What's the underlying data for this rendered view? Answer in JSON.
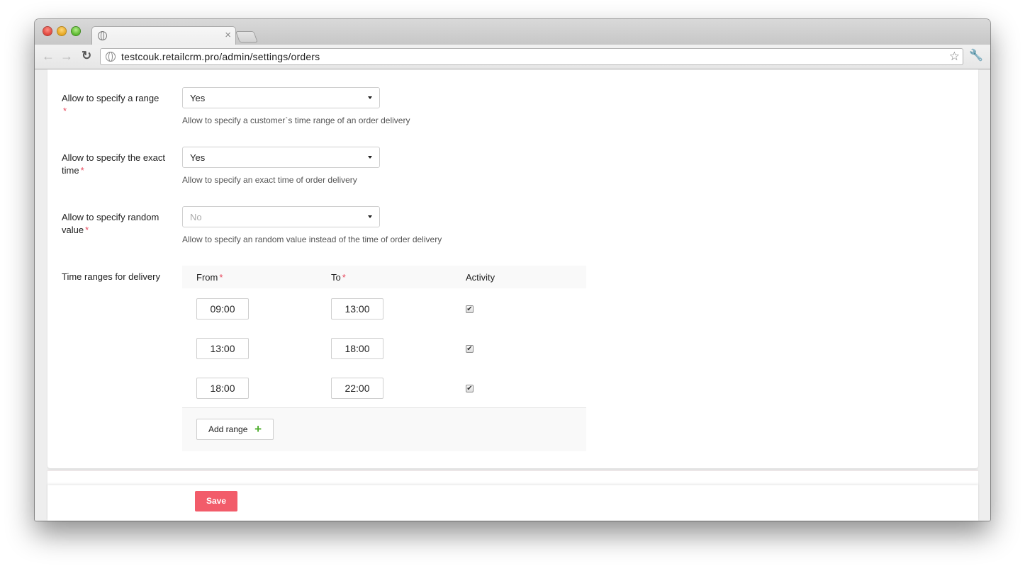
{
  "browser": {
    "url_host": "testcouk.retailcrm.pro",
    "url_path": "/admin/settings/orders",
    "tab_close": "×",
    "icons": [
      "globe-icon",
      "back-arrow-icon",
      "forward-arrow-icon",
      "reload-icon",
      "star-icon",
      "wrench-icon"
    ]
  },
  "form": {
    "range": {
      "label": "Allow to specify a range",
      "value": "Yes",
      "help": "Allow to specify a customer`s time range of an order delivery"
    },
    "exact": {
      "label": "Allow to specify the exact time",
      "value": "Yes",
      "help": "Allow to specify an exact time of order delivery"
    },
    "random": {
      "label": "Allow to specify random value",
      "value": "No",
      "help": "Allow to specify an random value instead of the time of order delivery"
    },
    "required_mark": "*",
    "time_ranges": {
      "label": "Time ranges for delivery",
      "columns": [
        "From",
        "To",
        "Activity"
      ],
      "rows": [
        {
          "from": "09:00",
          "to": "13:00",
          "active": true
        },
        {
          "from": "13:00",
          "to": "18:00",
          "active": true
        },
        {
          "from": "18:00",
          "to": "22:00",
          "active": true
        }
      ],
      "add_label": "Add range",
      "add_icon": "+"
    },
    "save_label": "Save"
  },
  "colors": {
    "accent": "#f25c6a",
    "required": "#e8485d",
    "add_icon": "#4fae2f"
  }
}
